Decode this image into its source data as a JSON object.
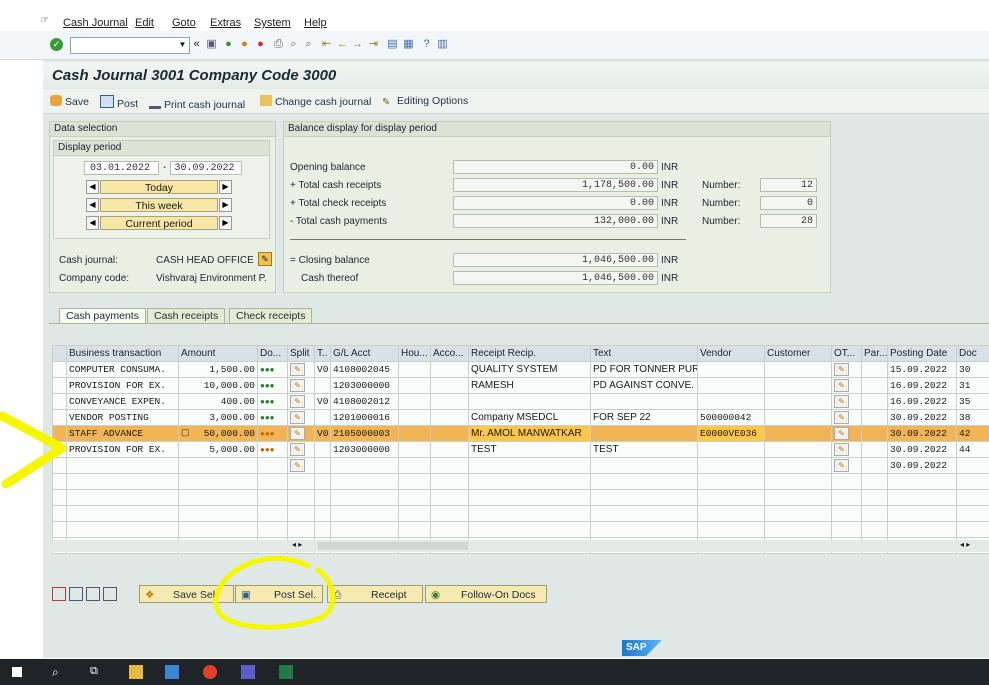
{
  "menu": {
    "items": [
      "Cash Journal",
      "Edit",
      "Goto",
      "Extras",
      "System",
      "Help"
    ]
  },
  "window_title": "Cash Journal 3001 Company Code 3000",
  "app_toolbar": {
    "save": "Save",
    "post": "Post",
    "print": "Print cash journal",
    "change": "Change cash journal",
    "editing": "Editing Options"
  },
  "data_selection": {
    "header": "Data selection",
    "period_header": "Display period",
    "from": "03.01.2022",
    "to": "30.09.2022",
    "separator": "-",
    "today": "Today",
    "this_week": "This week",
    "current_period": "Current period",
    "cash_journal_label": "Cash journal:",
    "cash_journal_value": "CASH HEAD OFFICE",
    "company_code_label": "Company code:",
    "company_code_value": "Vishvaraj Environment P."
  },
  "balance": {
    "header": "Balance display for display period",
    "opening_label": "Opening balance",
    "opening_value": "0.00",
    "receipts_label": "+ Total cash receipts",
    "receipts_value": "1,178,500.00",
    "checks_label": "+ Total check receipts",
    "checks_value": "0.00",
    "payments_label": "- Total cash payments",
    "payments_value": "132,000.00",
    "closing_label": "= Closing balance",
    "closing_value": "1,046,500.00",
    "cash_thereof_label": "Cash thereof",
    "cash_thereof_value": "1,046,500.00",
    "currency": "INR",
    "number_label": "Number:",
    "receipts_number": "12",
    "checks_number": "0",
    "payments_number": "28"
  },
  "tabs": [
    "Cash payments",
    "Cash receipts",
    "Check receipts"
  ],
  "table": {
    "headers": [
      "Business transaction",
      "Amount",
      "Do...",
      "Split",
      "T..",
      "G/L Acct",
      "Hou...",
      "Acco...",
      "Receipt Recip.",
      "Text",
      "Vendor",
      "Customer",
      "OT...",
      "Par...",
      "Posting Date",
      "Doc"
    ],
    "rows": [
      {
        "bt": "COMPUTER CONSUMA.",
        "amount": "1,500.00",
        "t": "V0",
        "gl": "4108002045",
        "recip": "QUALITY SYSTEM",
        "text": "PD FOR TONNER PUR.",
        "vendor": "",
        "date": "15.09.2022",
        "doc": "30"
      },
      {
        "bt": "PROVISION FOR EX.",
        "amount": "10,000.00",
        "t": "",
        "gl": "1203000000",
        "recip": "RAMESH",
        "text": "PD AGAINST CONVE.",
        "vendor": "",
        "date": "16.09.2022",
        "doc": "31"
      },
      {
        "bt": "CONVEYANCE EXPEN.",
        "amount": "400.00",
        "t": "V0",
        "gl": "4108002012",
        "recip": "",
        "text": "",
        "vendor": "",
        "date": "16.09.2022",
        "doc": "35"
      },
      {
        "bt": "VENDOR POSTING",
        "amount": "3,000.00",
        "t": "",
        "gl": "1201000016",
        "recip": "Company MSEDCL",
        "text": "FOR SEP 22",
        "vendor": "500000042",
        "date": "30.09.2022",
        "doc": "38"
      },
      {
        "bt": "STAFF ADVANCE",
        "amount": "50,000.00",
        "t": "V0",
        "gl": "2105000003",
        "recip": "Mr. AMOL MANWATKAR",
        "text": "",
        "vendor": "E0000VE036",
        "date": "30.09.2022",
        "doc": "42"
      },
      {
        "bt": "PROVISION FOR EX.",
        "amount": "5,000.00",
        "t": "",
        "gl": "1203000000",
        "recip": "TEST",
        "text": "TEST",
        "vendor": "",
        "date": "30.09.2022",
        "doc": "44"
      },
      {
        "bt": "",
        "amount": "",
        "t": "",
        "gl": "",
        "recip": "",
        "text": "",
        "vendor": "",
        "date": "30.09.2022",
        "doc": ""
      }
    ]
  },
  "bottom_buttons": {
    "save_sel": "Save Sel.",
    "post_sel": "Post Sel.",
    "receipt": "Receipt",
    "follow_on": "Follow-On Docs"
  },
  "sap_logo": "SAP",
  "colors": {
    "highlight_row": "#f3b455",
    "annotation_yellow": "#f5f700"
  }
}
